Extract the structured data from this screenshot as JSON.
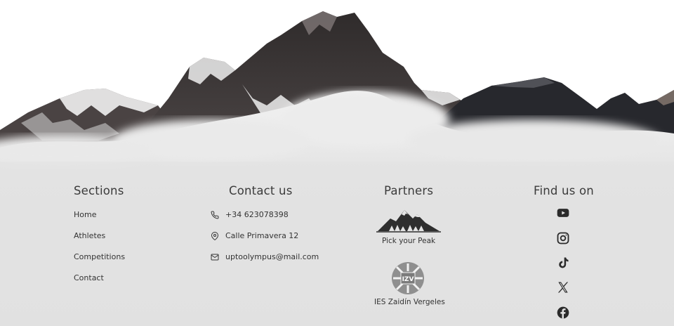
{
  "sections": {
    "title": "Sections",
    "links": [
      "Home",
      "Athletes",
      "Competitions",
      "Contact"
    ]
  },
  "contact": {
    "title": "Contact us",
    "phone": "+34 623078398",
    "address": "Calle Primavera 12",
    "email": "uptoolympus@mail.com",
    "icons": [
      "phone-icon",
      "location-pin-icon",
      "mail-icon"
    ]
  },
  "partners": {
    "title": "Partners",
    "items": [
      "Pick your Peak",
      "IES Zaidín Vergeles"
    ],
    "logo_text": "IZV"
  },
  "social": {
    "title": "Find us on",
    "icons": [
      "youtube-icon",
      "instagram-icon",
      "tiktok-icon",
      "x-icon",
      "facebook-icon"
    ]
  },
  "colors": {
    "text": "#333333",
    "heading": "#3b3b3b",
    "fog": "#e6e6e6",
    "rock": "#3a3636"
  }
}
